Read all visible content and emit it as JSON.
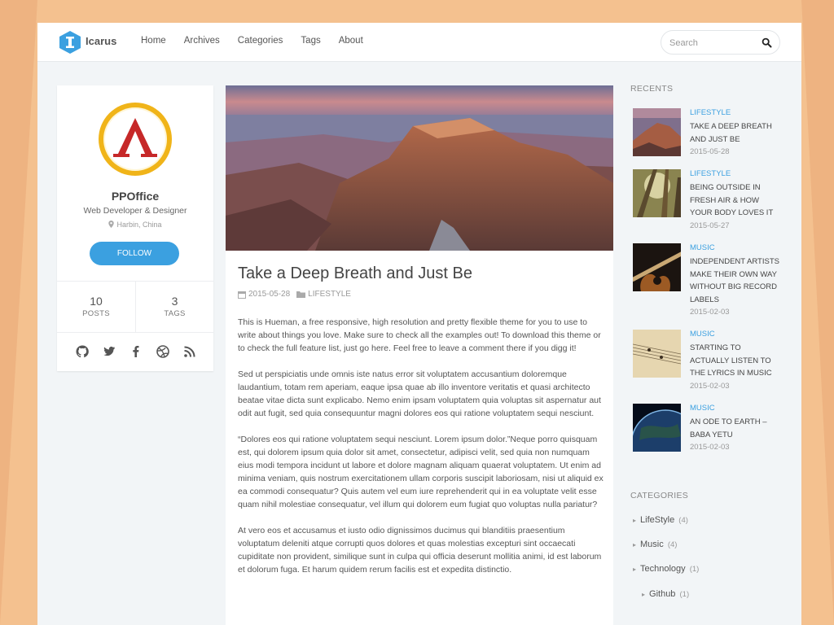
{
  "header": {
    "brand": "Icarus",
    "nav": [
      "Home",
      "Archives",
      "Categories",
      "Tags",
      "About"
    ],
    "search_placeholder": "Search"
  },
  "profile": {
    "name": "PPOffice",
    "role": "Web Developer & Designer",
    "location": "Harbin, China",
    "follow_label": "FOLLOW",
    "posts_count": "10",
    "posts_label": "POSTS",
    "tags_count": "3",
    "tags_label": "TAGS",
    "socials": [
      "github-icon",
      "twitter-icon",
      "facebook-icon",
      "dribbble-icon",
      "rss-icon"
    ]
  },
  "article": {
    "title": "Take a Deep Breath and Just Be",
    "date": "2015-05-28",
    "category": "LIFESTYLE",
    "paragraphs": [
      "This is Hueman, a free responsive, high resolution and pretty flexible theme for you to use to write about things you love. Make sure to check all the examples out! To download this theme or to check the full feature list, just go here. Feel free to leave a comment there if you digg it!",
      "Sed ut perspiciatis unde omnis iste natus error sit voluptatem accusantium doloremque laudantium, totam rem aperiam, eaque ipsa quae ab illo inventore veritatis et quasi architecto beatae vitae dicta sunt explicabo. Nemo enim ipsam voluptatem quia voluptas sit aspernatur aut odit aut fugit, sed quia consequuntur magni dolores eos qui ratione voluptatem sequi nesciunt.",
      "“Dolores eos qui ratione voluptatem sequi nesciunt. Lorem ipsum dolor.”Neque porro quisquam est, qui dolorem ipsum quia dolor sit amet, consectetur, adipisci velit, sed quia non numquam eius modi tempora incidunt ut labore et dolore magnam aliquam quaerat voluptatem. Ut enim ad minima veniam, quis nostrum exercitationem ullam corporis suscipit laboriosam, nisi ut aliquid ex ea commodi consequatur? Quis autem vel eum iure reprehenderit qui in ea voluptate velit esse quam nihil molestiae consequatur, vel illum qui dolorem eum fugiat quo voluptas nulla pariatur?",
      "At vero eos et accusamus et iusto odio dignissimos ducimus qui blanditiis praesentium voluptatum deleniti atque corrupti quos dolores et quas molestias excepturi sint occaecati cupiditate non provident, similique sunt in culpa qui officia deserunt mollitia animi, id est laborum et dolorum fuga. Et harum quidem rerum facilis est et expedita distinctio."
    ]
  },
  "sidebar": {
    "recents_heading": "RECENTS",
    "recents": [
      {
        "category": "LIFESTYLE",
        "title": "TAKE A DEEP BREATH AND JUST BE",
        "date": "2015-05-28"
      },
      {
        "category": "LIFESTYLE",
        "title": "BEING OUTSIDE IN FRESH AIR & HOW YOUR BODY LOVES IT",
        "date": "2015-05-27"
      },
      {
        "category": "MUSIC",
        "title": "INDEPENDENT ARTISTS MAKE THEIR OWN WAY WITHOUT BIG RECORD LABELS",
        "date": "2015-02-03"
      },
      {
        "category": "MUSIC",
        "title": "STARTING TO ACTUALLY LISTEN TO THE LYRICS IN MUSIC",
        "date": "2015-02-03"
      },
      {
        "category": "MUSIC",
        "title": "AN ODE TO EARTH – BABA YETU",
        "date": "2015-02-03"
      }
    ],
    "categories_heading": "CATEGORIES",
    "categories": [
      {
        "name": "LifeStyle",
        "count": "(4)"
      },
      {
        "name": "Music",
        "count": "(4)"
      },
      {
        "name": "Technology",
        "count": "(1)"
      },
      {
        "name": "Github",
        "count": "(1)"
      }
    ]
  },
  "colors": {
    "accent": "#3ba0e0",
    "page_bg": "#f4c18f",
    "content_bg": "#f2f5f7"
  }
}
